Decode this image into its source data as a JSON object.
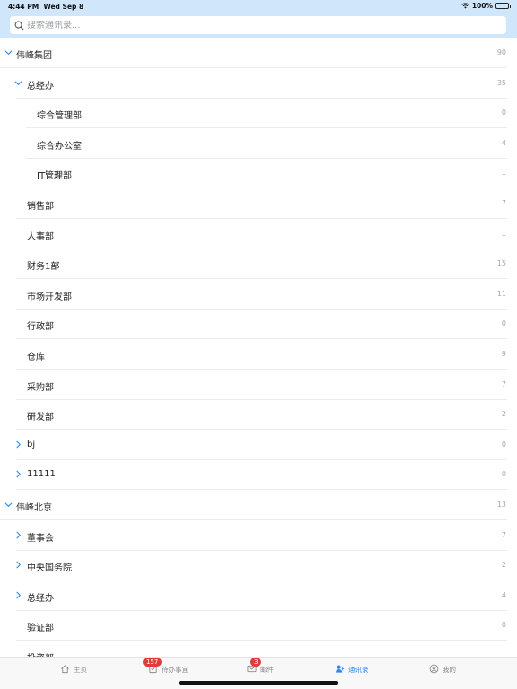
{
  "status": {
    "time": "4:44 PM",
    "date": "Wed Sep 8",
    "battery": "100%"
  },
  "search": {
    "placeholder": "搜索通讯录..."
  },
  "rows": [
    {
      "label": "伟峰集团",
      "count": "90",
      "level": 0,
      "chevron": "down"
    },
    {
      "label": "总经办",
      "count": "35",
      "level": 1,
      "chevron": "down"
    },
    {
      "label": "综合管理部",
      "count": "0",
      "level": 2,
      "chevron": "none"
    },
    {
      "label": "综合办公室",
      "count": "4",
      "level": 2,
      "chevron": "none"
    },
    {
      "label": "IT管理部",
      "count": "1",
      "level": 2,
      "chevron": "none"
    },
    {
      "label": "销售部",
      "count": "7",
      "level": 1,
      "chevron": "none"
    },
    {
      "label": "人事部",
      "count": "1",
      "level": 1,
      "chevron": "none"
    },
    {
      "label": "财务1部",
      "count": "15",
      "level": 1,
      "chevron": "none"
    },
    {
      "label": "市场开发部",
      "count": "11",
      "level": 1,
      "chevron": "none"
    },
    {
      "label": "行政部",
      "count": "0",
      "level": 1,
      "chevron": "none"
    },
    {
      "label": "仓库",
      "count": "9",
      "level": 1,
      "chevron": "none"
    },
    {
      "label": "采购部",
      "count": "7",
      "level": 1,
      "chevron": "none"
    },
    {
      "label": "研发部",
      "count": "2",
      "level": 1,
      "chevron": "none"
    },
    {
      "label": "bj",
      "count": "0",
      "level": 1,
      "chevron": "right"
    },
    {
      "label": "11111",
      "count": "0",
      "level": 1,
      "chevron": "right"
    },
    {
      "label": "伟峰北京",
      "count": "13",
      "level": 0,
      "chevron": "down"
    },
    {
      "label": "董事会",
      "count": "7",
      "level": 1,
      "chevron": "right"
    },
    {
      "label": "中央国务院",
      "count": "2",
      "level": 1,
      "chevron": "right"
    },
    {
      "label": "总经办",
      "count": "4",
      "level": 1,
      "chevron": "right"
    },
    {
      "label": "验证部",
      "count": "0",
      "level": 1,
      "chevron": "none"
    },
    {
      "label": "投资部",
      "count": "",
      "level": 1,
      "chevron": "none"
    }
  ],
  "tabs": [
    {
      "label": "主页",
      "icon": "home-icon",
      "active": false,
      "badge": ""
    },
    {
      "label": "待办事宜",
      "icon": "todo-icon",
      "active": false,
      "badge": "157"
    },
    {
      "label": "邮件",
      "icon": "mail-icon",
      "active": false,
      "badge": "3"
    },
    {
      "label": "通讯录",
      "icon": "contacts-icon",
      "active": true,
      "badge": ""
    },
    {
      "label": "我的",
      "icon": "profile-icon",
      "active": false,
      "badge": ""
    }
  ],
  "colors": {
    "accent": "#2f88e8",
    "header": "#cfe6fb",
    "badge": "#e23b3b"
  }
}
